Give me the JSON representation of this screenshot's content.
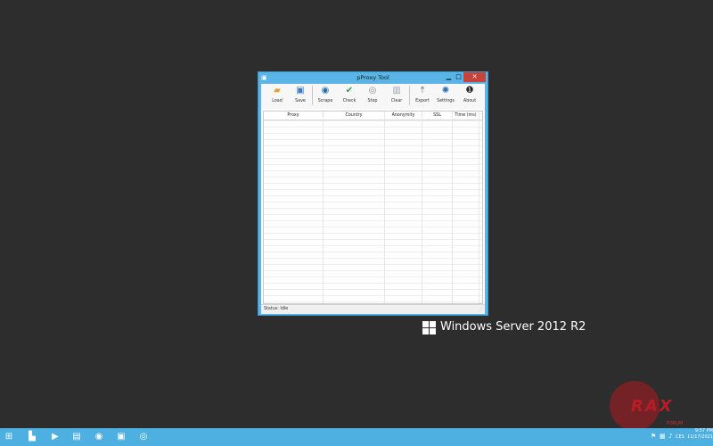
{
  "window": {
    "title": "pProxy Tool",
    "controls": {
      "minimize": "▁",
      "maximize": "□",
      "close": "✕"
    }
  },
  "toolbar": {
    "buttons": [
      {
        "label": "Load",
        "icon": "folder-icon"
      },
      {
        "label": "Save",
        "icon": "floppy-icon"
      },
      {
        "label": "Scrape",
        "icon": "scrape-icon"
      },
      {
        "label": "Check",
        "icon": "check-icon"
      },
      {
        "label": "Stop",
        "icon": "stop-icon"
      },
      {
        "label": "Clear",
        "icon": "trash-icon"
      },
      {
        "label": "Export",
        "icon": "export-icon"
      },
      {
        "label": "Settings",
        "icon": "gear-icon"
      },
      {
        "label": "About",
        "icon": "info-icon"
      }
    ]
  },
  "grid": {
    "columns": [
      "Proxy",
      "Country",
      "Anonymity",
      "SSL",
      "Time (ms)"
    ]
  },
  "status": {
    "text": "Status: Idle"
  },
  "branding": {
    "text": "Windows Server 2012 R2"
  },
  "watermark": {
    "text": "RAX",
    "sub": "FORUM"
  },
  "taskbar": {
    "clock_time": "9:57 PM",
    "clock_date": "11/17/2021",
    "lang": "CES"
  },
  "colors": {
    "desktop": "#2d2d2d",
    "window_frame": "#5ab5e6",
    "close_button": "#c7423a",
    "taskbar": "#4db0e0"
  }
}
